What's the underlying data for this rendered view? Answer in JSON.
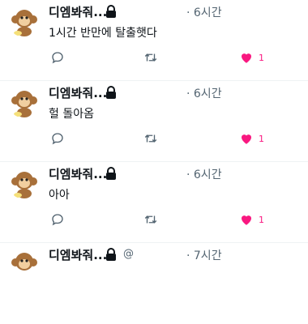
{
  "tweets": [
    {
      "author": "디엠봐줘...",
      "time": "· 6시간",
      "text": "1시간 반만에 탈출햇다",
      "likes": "1",
      "handle": ""
    },
    {
      "author": "디엠봐줘...",
      "time": "· 6시간",
      "text": "헐 돌아옴",
      "likes": "1",
      "handle": ""
    },
    {
      "author": "디엠봐줘...",
      "time": "· 6시간",
      "text": "아아",
      "likes": "1",
      "handle": ""
    },
    {
      "author": "디엠봐줘...",
      "time": "· 7시간",
      "text": "",
      "likes": "",
      "handle": "@"
    }
  ],
  "icons": {
    "avatar": "monkey-avatar-icon",
    "lock": "lock-icon",
    "reply": "reply-icon",
    "retweet": "retweet-icon",
    "like": "heart-icon"
  },
  "colors": {
    "like": "#f91880",
    "muted": "#536471",
    "text": "#0f1419"
  }
}
